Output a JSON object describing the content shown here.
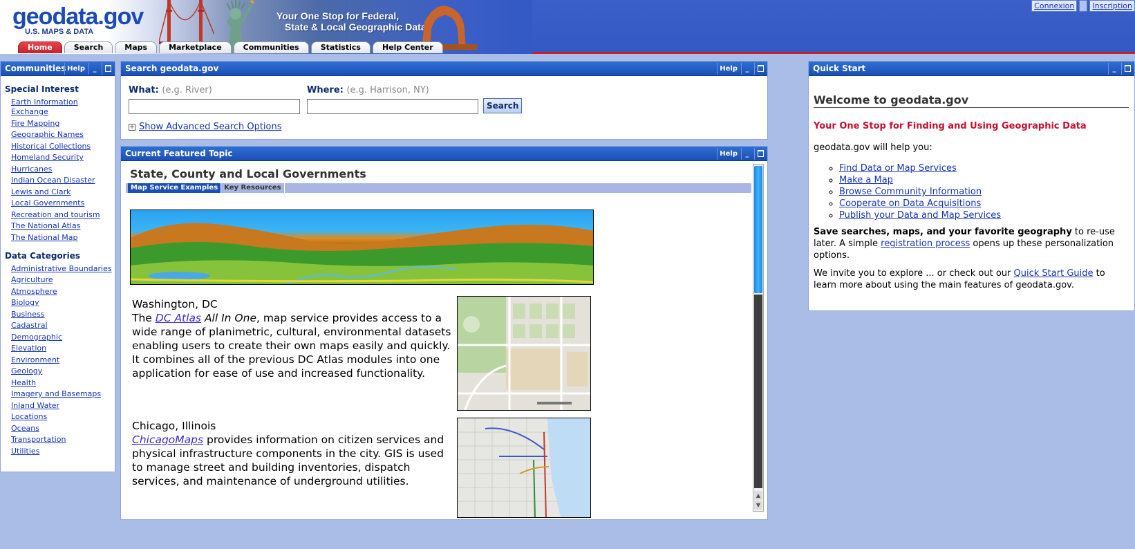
{
  "header": {
    "logo": "geodata.gov",
    "logo_sub": "U.S. MAPS & DATA",
    "tagline_1": "Your One Stop for Federal,",
    "tagline_2": "State & Local Geographic Data",
    "links": [
      "Connexion",
      "Inscription"
    ],
    "tabs": [
      "Home",
      "Search",
      "Maps",
      "Marketplace",
      "Communities",
      "Statistics",
      "Help Center"
    ],
    "active_tab": "Home"
  },
  "portlet_controls": {
    "help": "Help",
    "minimize": "_"
  },
  "communities": {
    "title": "Communities",
    "special_interest": {
      "heading": "Special Interest",
      "items": [
        "Earth Information Exchange",
        "Fire Mapping",
        "Geographic Names",
        "Historical Collections",
        "Homeland Security",
        "Hurricanes",
        "Indian Ocean Disaster",
        "Lewis and Clark",
        "Local Governments",
        "Recreation and tourism",
        "The National Atlas",
        "The National Map"
      ]
    },
    "data_categories": {
      "heading": "Data Categories",
      "items": [
        "Administrative Boundaries",
        "Agriculture",
        "Atmosphere",
        "Biology",
        "Business",
        "Cadastral",
        "Demographic",
        "Elevation",
        "Environment",
        "Geology",
        "Health",
        "Imagery and Basemaps",
        "Inland Water",
        "Locations",
        "Oceans",
        "Transportation",
        "Utilities"
      ]
    }
  },
  "search": {
    "title": "Search geodata.gov",
    "what_label": "What:",
    "what_hint": "(e.g. River)",
    "what_value": "",
    "where_label": "Where:",
    "where_hint": "(e.g. Harrison, NY)",
    "where_value": "",
    "button": "Search",
    "advanced_link": "Show Advanced Search Options"
  },
  "featured": {
    "title": "Current Featured Topic",
    "topic": "State, County and Local Governments",
    "subtabs": [
      "Map Service Examples",
      "Key Resources"
    ],
    "active_subtab": "Map Service Examples",
    "dc": {
      "place": "Washington, DC",
      "prefix": "The",
      "link": "DC Atlas",
      "italic": "All In One",
      "body": ", map service provides access to a wide range of planimetric, cultural, environmental datasets enabling users to create their own maps easily and quickly. It combines all of the previous DC Atlas modules into one application for ease of use and increased functionality."
    },
    "chicago": {
      "place": "Chicago, Illinois",
      "link": "ChicagoMaps",
      "body": " provides information on citizen services and physical infrastructure components in the city. GIS is used to manage street and building inventories, dispatch services, and maintenance of underground utilities."
    }
  },
  "quickstart": {
    "title": "Quick Start",
    "heading": "Welcome to geodata.gov",
    "tagline": "Your One Stop for Finding and Using Geographic Data",
    "intro": "geodata.gov will help you:",
    "list": [
      "Find Data or Map Services",
      "Make a Map",
      "Browse Community Information",
      "Cooperate on Data Acquisitions",
      "Publish your Data and Map Services"
    ],
    "save_bold": "Save searches, maps, and your favorite geography",
    "save_mid": " to re-use later. A simple ",
    "save_link": "registration process",
    "save_end": " opens up these personalization options.",
    "invite_pre": "We invite you to explore ... or check out our ",
    "invite_link": "Quick Start Guide",
    "invite_end": " to learn more about using the main features of geodata.gov."
  },
  "colors": {
    "title_bar": "#1a4fb6",
    "brand_red": "#c8202a",
    "page_bg": "#a9bde6",
    "link": "#1533b5"
  }
}
